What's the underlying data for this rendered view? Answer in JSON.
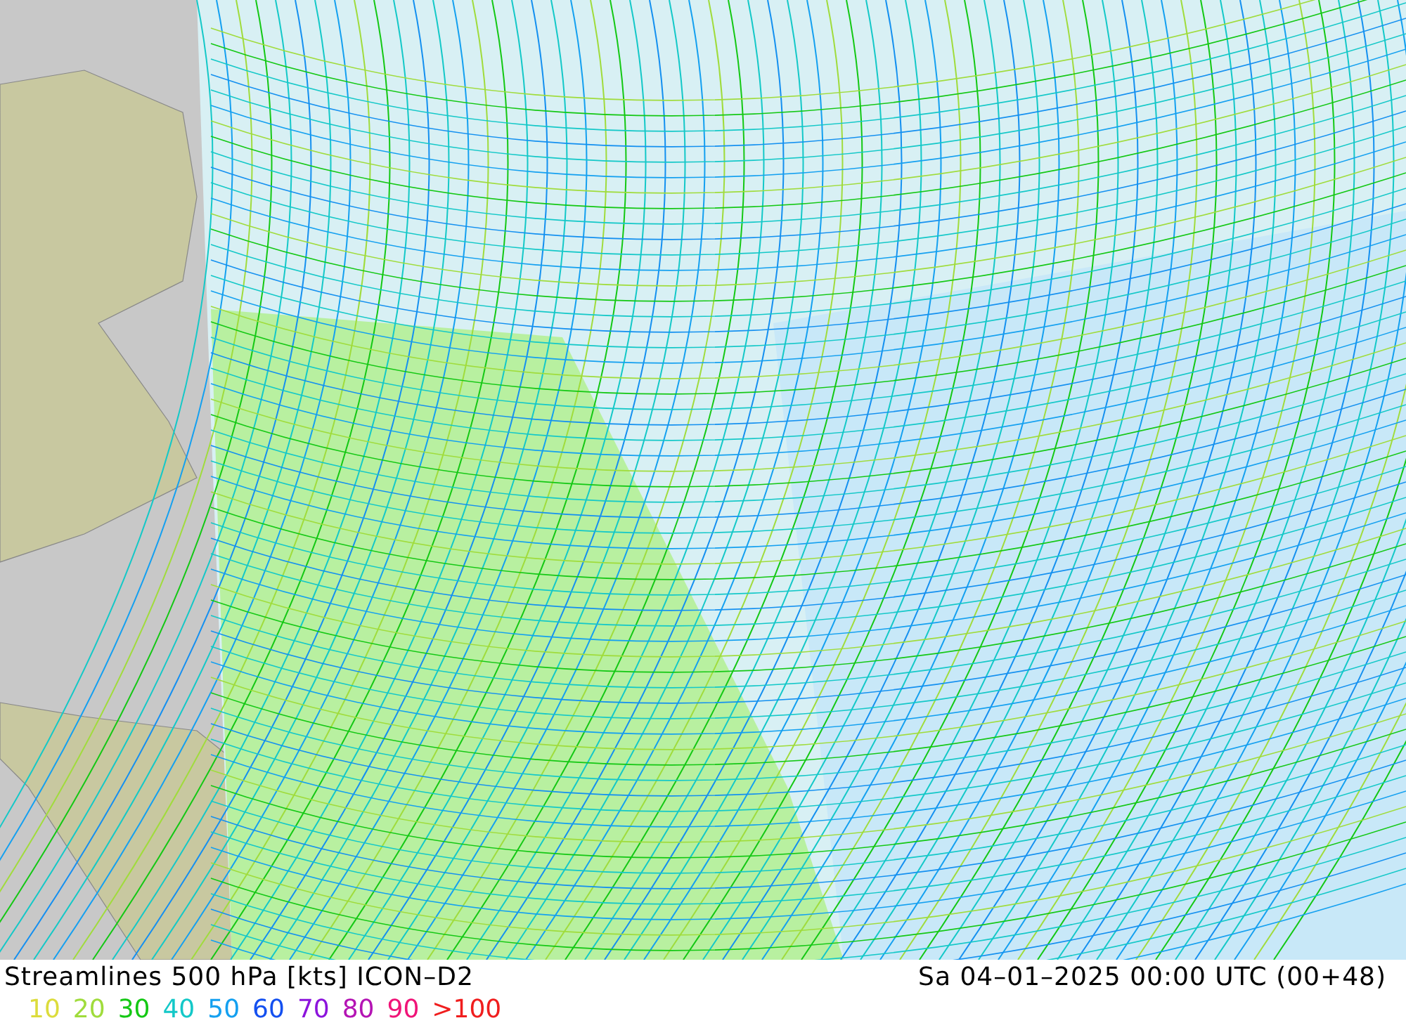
{
  "title": "Streamlines 500 hPa [kts] ICON–D2",
  "valid_time": "Sa 04–01–2025 00:00 UTC (00+48)",
  "legend": [
    {
      "label": "10",
      "color": "#dcdc3c"
    },
    {
      "label": "20",
      "color": "#a0dc3c"
    },
    {
      "label": "30",
      "color": "#14c814"
    },
    {
      "label": "40",
      "color": "#14c8c8"
    },
    {
      "label": "50",
      "color": "#14a0f0"
    },
    {
      "label": "60",
      "color": "#1450f0"
    },
    {
      "label": "70",
      "color": "#8c14dc"
    },
    {
      "label": "80",
      "color": "#b414b4"
    },
    {
      "label": "90",
      "color": "#f01478"
    },
    {
      "label": ">100",
      "color": "#f01e1e"
    }
  ]
}
